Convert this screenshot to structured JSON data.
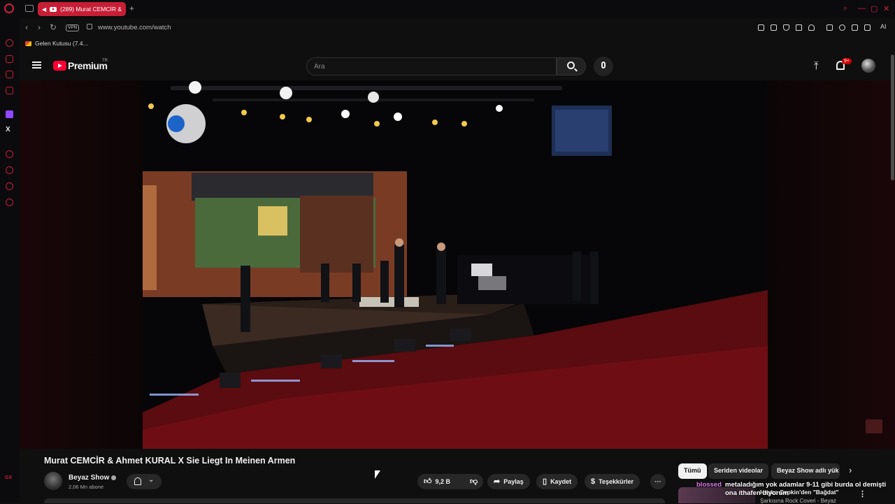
{
  "browser": {
    "tab_title": "(289) Murat CEMCİR &",
    "new_tab": "+",
    "url": "www.youtube.com/watch",
    "vpn": "VPN",
    "ai_label": "AI",
    "bookmark": "Gelen Kutusu (7.4..."
  },
  "masthead": {
    "logo_text": "Premium",
    "logo_region": "TR",
    "search_placeholder": "Ara",
    "notifications": "9+"
  },
  "video": {
    "title": "Murat CEMCİR & Ahmet KURAL X Sie Liegt In Meinen Armen",
    "channel": "Beyaz Show",
    "subscribers": "2,06 Mn abone",
    "likes": "9,2 B",
    "share": "Paylaş",
    "save": "Kaydet",
    "thanks": "Teşekkürler",
    "more": "···"
  },
  "chips": [
    "Tümü",
    "Seriden videolar",
    "Beyaz Show adlı yük"
  ],
  "chat": {
    "user": "blossed",
    "message": "metaladığım yok adamlar 9-11 gibi burda ol demişti",
    "message2": "ona ithafen diyorum"
  },
  "recommendation": {
    "title": "Hayko Cepkin'den \"Bağdat\"",
    "subtitle": "Şarkısına Rock Coveri - Beyaz"
  },
  "colors": {
    "accent": "#ff0033",
    "opera_red": "#c81e35",
    "background": "#0f0f0f"
  }
}
